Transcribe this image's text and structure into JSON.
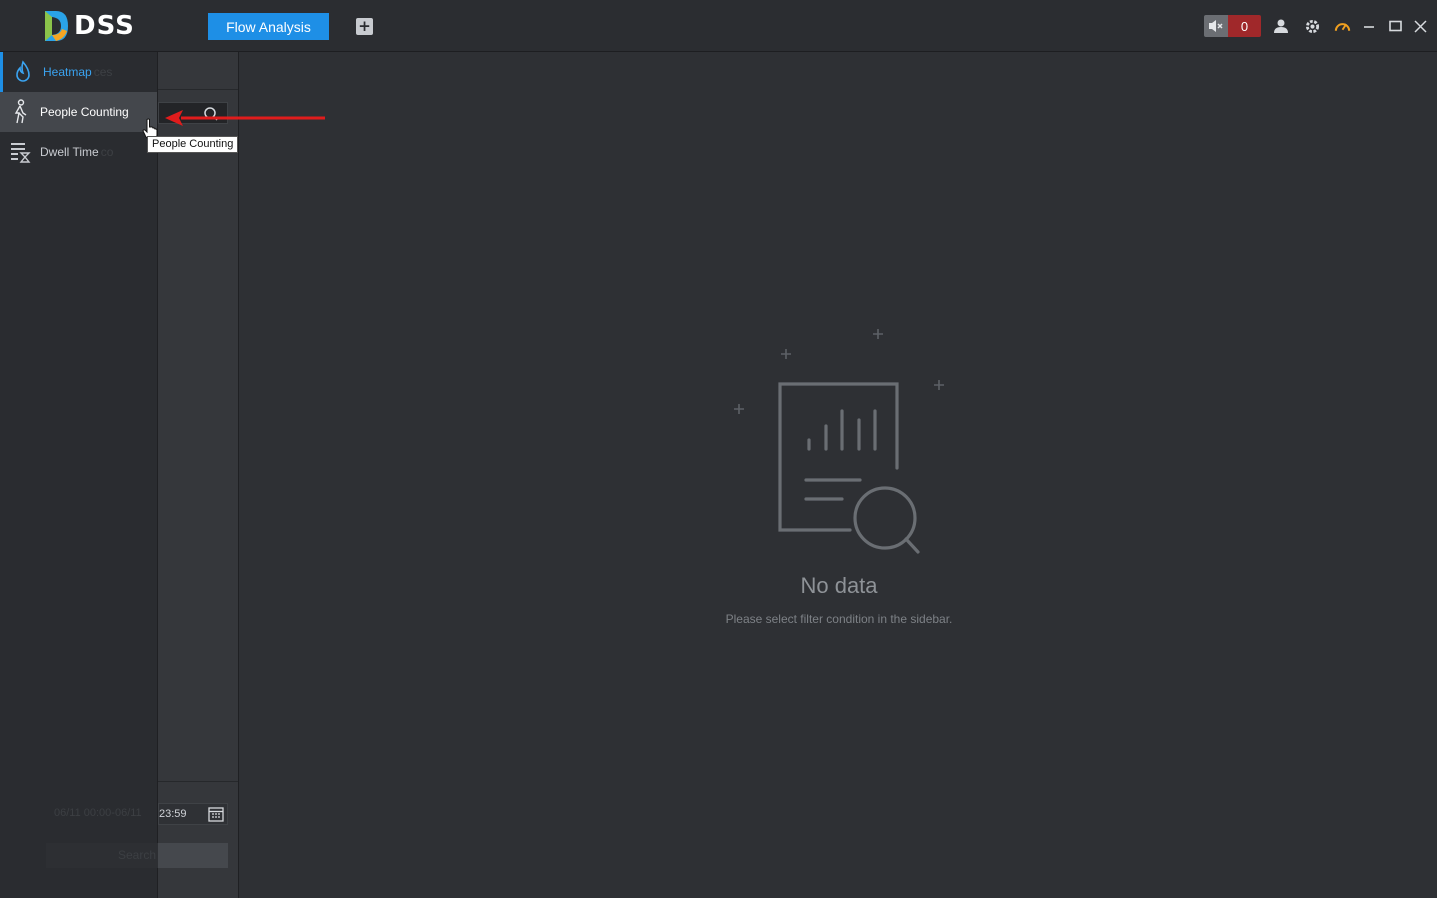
{
  "app": {
    "logo_text": "DSS",
    "active_tab": "Flow Analysis",
    "alarm_count": "0"
  },
  "nav": {
    "items": [
      {
        "label": "Heatmap",
        "icon": "flame-icon",
        "ghost": "ces"
      },
      {
        "label": "People Counting",
        "icon": "person-walking-icon"
      },
      {
        "label": "Dwell Time",
        "icon": "list-hourglass-icon",
        "ghost": "co"
      }
    ]
  },
  "tooltip": "People Counting",
  "sidebar": {
    "date_visible": "23:59",
    "date_faded": "06/11 00:00-06/11",
    "search_label": "Search"
  },
  "empty": {
    "title": "No data",
    "hint": "Please select filter condition in the sidebar."
  },
  "colors": {
    "accent": "#1e8fe6",
    "alarm": "#a0282a",
    "background": "#2e3034",
    "arrow": "#e01c1c"
  }
}
